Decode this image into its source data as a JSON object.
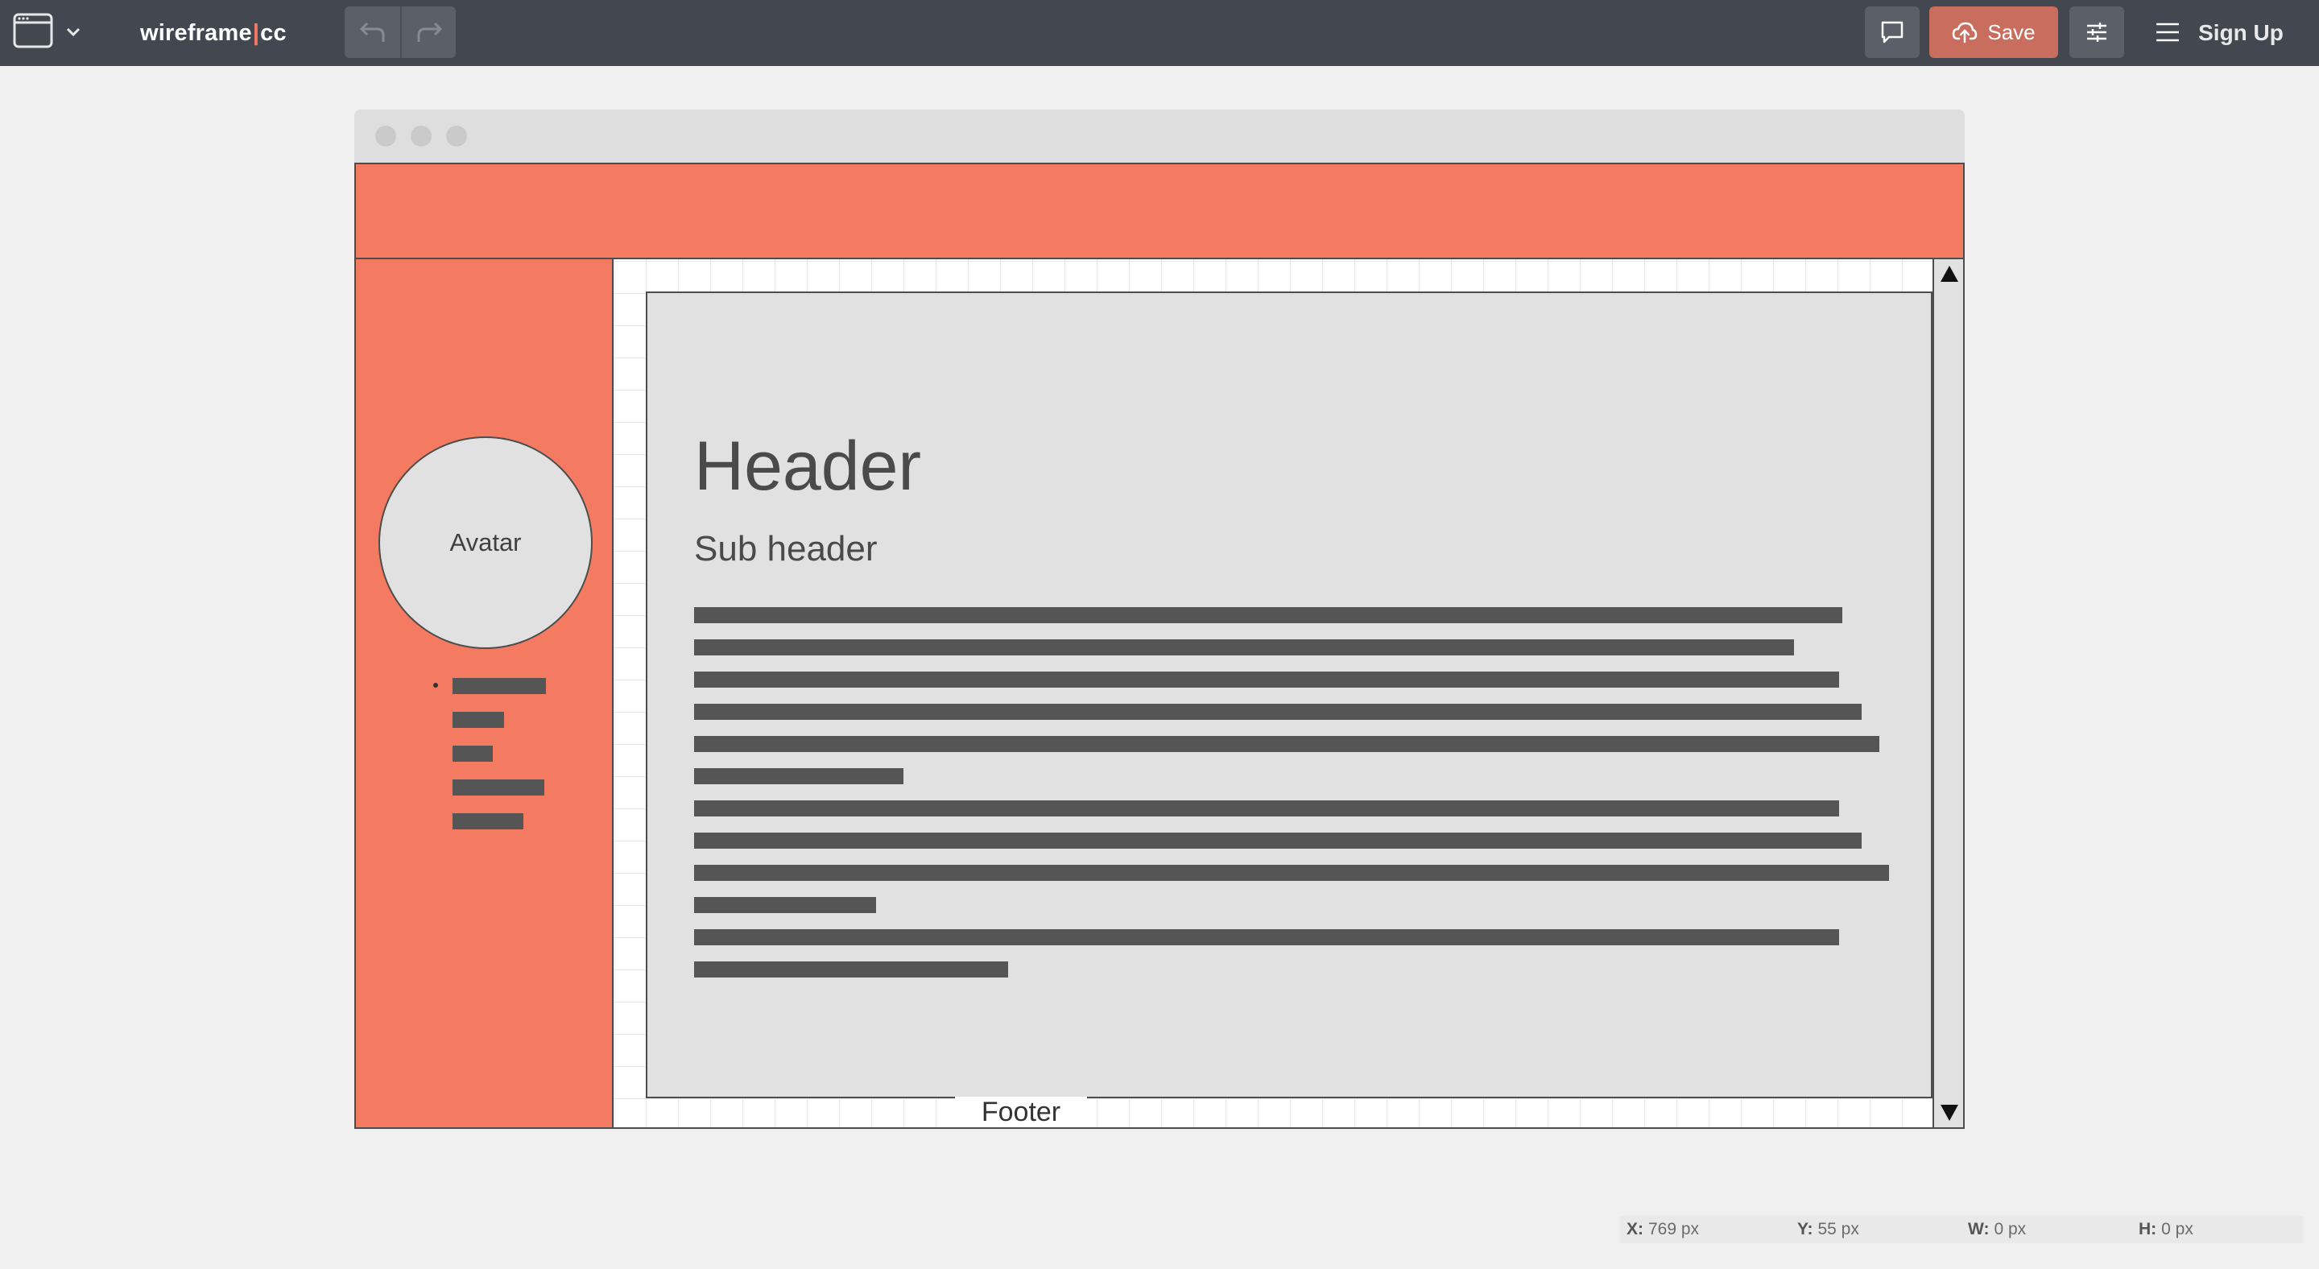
{
  "toolbar": {
    "brand_left": "wireframe",
    "brand_sep": "|",
    "brand_right": "cc",
    "save_label": "Save",
    "signup_label": "Sign Up",
    "icons": [
      "browser-window-icon",
      "chevron-down-icon",
      "undo-icon",
      "redo-icon",
      "comment-icon",
      "cloud-upload-icon",
      "sliders-icon",
      "hamburger-menu-icon"
    ]
  },
  "wireframe": {
    "avatar_label": "Avatar",
    "header": "Header",
    "subheader": "Sub header",
    "footer": "Footer"
  },
  "status": {
    "x_label": "X:",
    "x_value": "769 px",
    "y_label": "Y:",
    "y_value": "55 px",
    "w_label": "W:",
    "w_value": "0 px",
    "h_label": "H:",
    "h_value": "0 px"
  },
  "colors": {
    "toolbar_bg": "#434750",
    "accent": "#f47b62",
    "save_button": "#c96e5e",
    "placeholder_block": "#e1e1e1",
    "text_line": "#555555"
  }
}
